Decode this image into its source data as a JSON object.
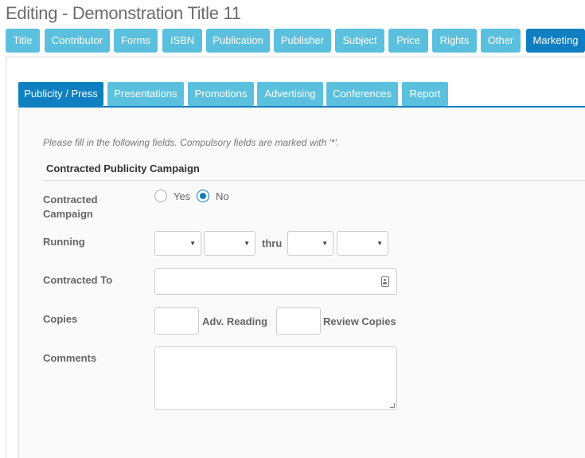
{
  "page_title": "Editing - Demonstration Title 11",
  "top_tabs": [
    {
      "label": "Title",
      "active": false
    },
    {
      "label": "Contributor",
      "active": false
    },
    {
      "label": "Forms",
      "active": false
    },
    {
      "label": "ISBN",
      "active": false
    },
    {
      "label": "Publication",
      "active": false
    },
    {
      "label": "Publisher",
      "active": false
    },
    {
      "label": "Subject",
      "active": false
    },
    {
      "label": "Price",
      "active": false
    },
    {
      "label": "Rights",
      "active": false
    },
    {
      "label": "Other",
      "active": false
    },
    {
      "label": "Marketing",
      "active": true
    }
  ],
  "sub_tabs": [
    {
      "label": "Publicity / Press",
      "active": true
    },
    {
      "label": "Presentations",
      "active": false
    },
    {
      "label": "Promotions",
      "active": false
    },
    {
      "label": "Advertising",
      "active": false
    },
    {
      "label": "Conferences",
      "active": false
    },
    {
      "label": "Report",
      "active": false
    }
  ],
  "form": {
    "instructions": "Please fill in the following fields. Compulsory fields are marked with '*'.",
    "section_title": "Contracted Publicity Campaign",
    "contracted_campaign": {
      "label_line1": "Contracted",
      "label_line2": "Campaign",
      "yes_label": "Yes",
      "no_label": "No",
      "selected": "No"
    },
    "running": {
      "label": "Running",
      "thru_label": "thru",
      "start_month": "",
      "start_year": "",
      "end_month": "",
      "end_year": ""
    },
    "contracted_to": {
      "label": "Contracted To",
      "value": "",
      "icon": "contact-card-icon"
    },
    "copies": {
      "label": "Copies",
      "adv_reading_value": "",
      "adv_reading_label": "Adv. Reading",
      "review_copies_value": "",
      "review_copies_label": "Review Copies"
    },
    "comments": {
      "label": "Comments",
      "value": ""
    }
  },
  "colors": {
    "tab_default": "#5bc0de",
    "tab_active": "#0f7fc1"
  }
}
